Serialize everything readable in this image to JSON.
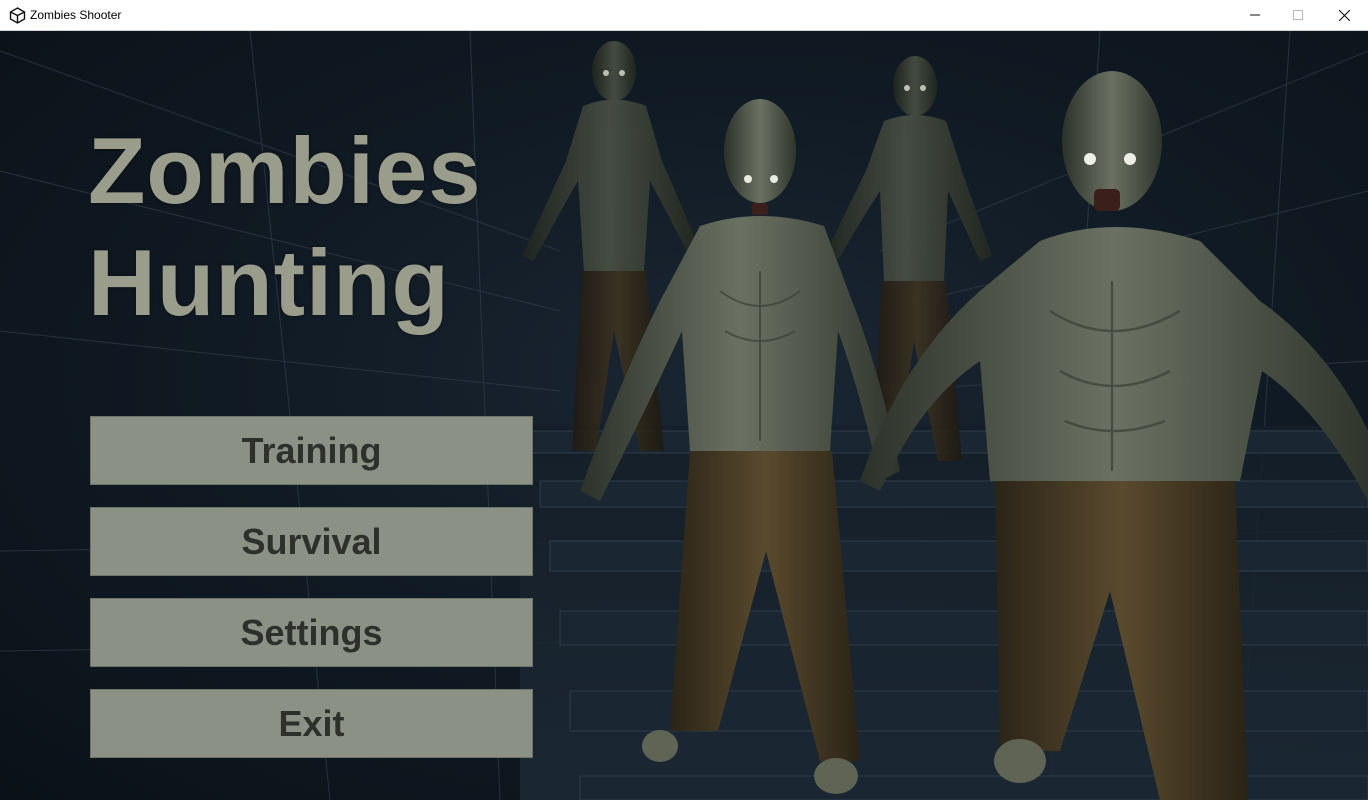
{
  "window": {
    "title": "Zombies Shooter",
    "icons": [
      "unity-logo-icon",
      "minimize-icon",
      "maximize-icon",
      "close-icon"
    ]
  },
  "game": {
    "title_line1": "Zombies",
    "title_line2": "Hunting"
  },
  "menu": {
    "training": "Training",
    "survival": "Survival",
    "settings": "Settings",
    "exit": "Exit"
  },
  "colors": {
    "title_text": "#9b9d8c",
    "button_bg": "#8c9186",
    "button_text": "#2e302b",
    "background": "#0e1720"
  }
}
